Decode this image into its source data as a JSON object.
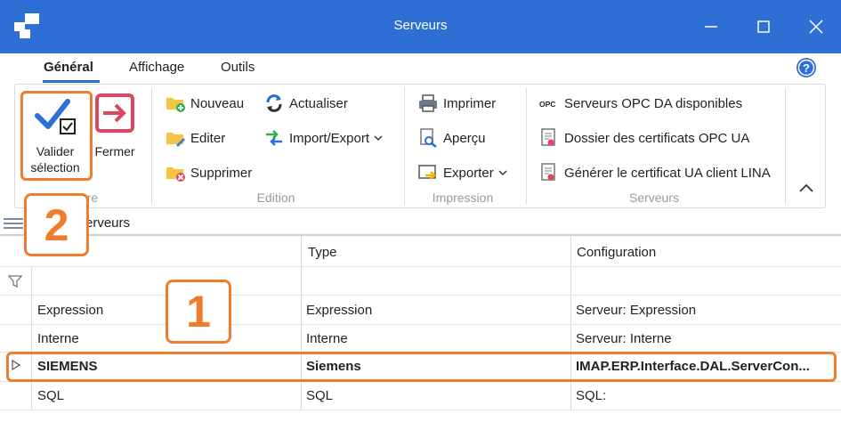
{
  "window": {
    "title": "Serveurs"
  },
  "menu_tabs": [
    {
      "label": "Général",
      "active": true
    },
    {
      "label": "Affichage",
      "active": false
    },
    {
      "label": "Outils",
      "active": false
    }
  ],
  "ribbon": {
    "fenetre_group": {
      "label": "Fenêtre",
      "visible_label": "tre",
      "valider": {
        "line1": "Valider",
        "line2": "sélection"
      },
      "fermer": {
        "label": "Fermer"
      }
    },
    "edition_group": {
      "label": "Edition",
      "nouveau": "Nouveau",
      "editer": "Editer",
      "supprimer": "Supprimer",
      "actualiser": "Actualiser",
      "import_export": "Import/Export"
    },
    "impression_group": {
      "label": "Impression",
      "imprimer": "Imprimer",
      "apercu": "Aperçu",
      "exporter": "Exporter"
    },
    "serveurs_group": {
      "label": "Serveurs",
      "opc_da": "Serveurs OPC DA disponibles",
      "dossier_certificats": "Dossier des certificats OPC UA",
      "generer_certificat": "Générer le certificat UA client LINA"
    }
  },
  "breadcrumb": {
    "visible_text": "erveurs"
  },
  "grid": {
    "columns": [
      "",
      "Type",
      "Configuration"
    ],
    "rows": [
      {
        "name": "Expression",
        "type": "Expression",
        "config": "Serveur: Expression",
        "selected": false
      },
      {
        "name": "Interne",
        "type": "Interne",
        "config": "Serveur: Interne",
        "selected": false
      },
      {
        "name": "SIEMENS",
        "type": "Siemens",
        "config": "IMAP.ERP.Interface.DAL.ServerCon...",
        "selected": true
      },
      {
        "name": "SQL",
        "type": "SQL",
        "config": "SQL:",
        "selected": false
      }
    ]
  },
  "callouts": [
    {
      "number": "2"
    },
    {
      "number": "1"
    }
  ],
  "colors": {
    "titlebar": "#2e6fd6",
    "accent": "#2e6fd6",
    "callout": "#ef7d2d"
  }
}
